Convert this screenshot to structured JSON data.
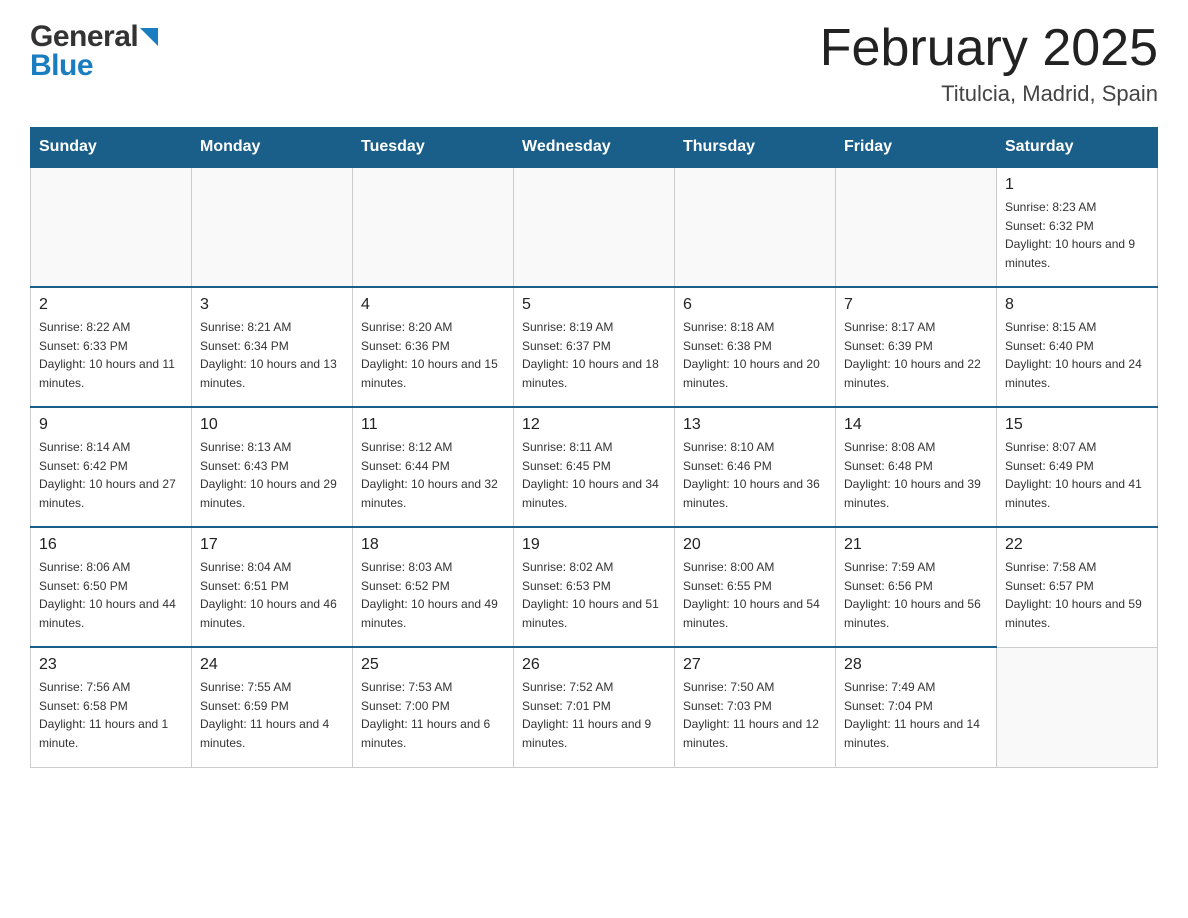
{
  "logo": {
    "general": "General",
    "blue": "Blue",
    "arrow_color": "#1a7dbf"
  },
  "header": {
    "month_year": "February 2025",
    "location": "Titulcia, Madrid, Spain"
  },
  "weekdays": [
    "Sunday",
    "Monday",
    "Tuesday",
    "Wednesday",
    "Thursday",
    "Friday",
    "Saturday"
  ],
  "weeks": [
    [
      {
        "day": "",
        "info": ""
      },
      {
        "day": "",
        "info": ""
      },
      {
        "day": "",
        "info": ""
      },
      {
        "day": "",
        "info": ""
      },
      {
        "day": "",
        "info": ""
      },
      {
        "day": "",
        "info": ""
      },
      {
        "day": "1",
        "info": "Sunrise: 8:23 AM\nSunset: 6:32 PM\nDaylight: 10 hours and 9 minutes."
      }
    ],
    [
      {
        "day": "2",
        "info": "Sunrise: 8:22 AM\nSunset: 6:33 PM\nDaylight: 10 hours and 11 minutes."
      },
      {
        "day": "3",
        "info": "Sunrise: 8:21 AM\nSunset: 6:34 PM\nDaylight: 10 hours and 13 minutes."
      },
      {
        "day": "4",
        "info": "Sunrise: 8:20 AM\nSunset: 6:36 PM\nDaylight: 10 hours and 15 minutes."
      },
      {
        "day": "5",
        "info": "Sunrise: 8:19 AM\nSunset: 6:37 PM\nDaylight: 10 hours and 18 minutes."
      },
      {
        "day": "6",
        "info": "Sunrise: 8:18 AM\nSunset: 6:38 PM\nDaylight: 10 hours and 20 minutes."
      },
      {
        "day": "7",
        "info": "Sunrise: 8:17 AM\nSunset: 6:39 PM\nDaylight: 10 hours and 22 minutes."
      },
      {
        "day": "8",
        "info": "Sunrise: 8:15 AM\nSunset: 6:40 PM\nDaylight: 10 hours and 24 minutes."
      }
    ],
    [
      {
        "day": "9",
        "info": "Sunrise: 8:14 AM\nSunset: 6:42 PM\nDaylight: 10 hours and 27 minutes."
      },
      {
        "day": "10",
        "info": "Sunrise: 8:13 AM\nSunset: 6:43 PM\nDaylight: 10 hours and 29 minutes."
      },
      {
        "day": "11",
        "info": "Sunrise: 8:12 AM\nSunset: 6:44 PM\nDaylight: 10 hours and 32 minutes."
      },
      {
        "day": "12",
        "info": "Sunrise: 8:11 AM\nSunset: 6:45 PM\nDaylight: 10 hours and 34 minutes."
      },
      {
        "day": "13",
        "info": "Sunrise: 8:10 AM\nSunset: 6:46 PM\nDaylight: 10 hours and 36 minutes."
      },
      {
        "day": "14",
        "info": "Sunrise: 8:08 AM\nSunset: 6:48 PM\nDaylight: 10 hours and 39 minutes."
      },
      {
        "day": "15",
        "info": "Sunrise: 8:07 AM\nSunset: 6:49 PM\nDaylight: 10 hours and 41 minutes."
      }
    ],
    [
      {
        "day": "16",
        "info": "Sunrise: 8:06 AM\nSunset: 6:50 PM\nDaylight: 10 hours and 44 minutes."
      },
      {
        "day": "17",
        "info": "Sunrise: 8:04 AM\nSunset: 6:51 PM\nDaylight: 10 hours and 46 minutes."
      },
      {
        "day": "18",
        "info": "Sunrise: 8:03 AM\nSunset: 6:52 PM\nDaylight: 10 hours and 49 minutes."
      },
      {
        "day": "19",
        "info": "Sunrise: 8:02 AM\nSunset: 6:53 PM\nDaylight: 10 hours and 51 minutes."
      },
      {
        "day": "20",
        "info": "Sunrise: 8:00 AM\nSunset: 6:55 PM\nDaylight: 10 hours and 54 minutes."
      },
      {
        "day": "21",
        "info": "Sunrise: 7:59 AM\nSunset: 6:56 PM\nDaylight: 10 hours and 56 minutes."
      },
      {
        "day": "22",
        "info": "Sunrise: 7:58 AM\nSunset: 6:57 PM\nDaylight: 10 hours and 59 minutes."
      }
    ],
    [
      {
        "day": "23",
        "info": "Sunrise: 7:56 AM\nSunset: 6:58 PM\nDaylight: 11 hours and 1 minute."
      },
      {
        "day": "24",
        "info": "Sunrise: 7:55 AM\nSunset: 6:59 PM\nDaylight: 11 hours and 4 minutes."
      },
      {
        "day": "25",
        "info": "Sunrise: 7:53 AM\nSunset: 7:00 PM\nDaylight: 11 hours and 6 minutes."
      },
      {
        "day": "26",
        "info": "Sunrise: 7:52 AM\nSunset: 7:01 PM\nDaylight: 11 hours and 9 minutes."
      },
      {
        "day": "27",
        "info": "Sunrise: 7:50 AM\nSunset: 7:03 PM\nDaylight: 11 hours and 12 minutes."
      },
      {
        "day": "28",
        "info": "Sunrise: 7:49 AM\nSunset: 7:04 PM\nDaylight: 11 hours and 14 minutes."
      },
      {
        "day": "",
        "info": ""
      }
    ]
  ]
}
